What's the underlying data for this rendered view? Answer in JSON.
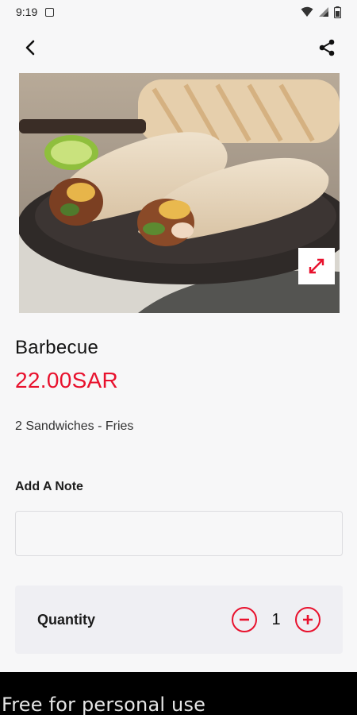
{
  "status_bar": {
    "time": "9:19",
    "icons": [
      "notification-icon",
      "wifi-icon",
      "signal-icon",
      "battery-icon"
    ]
  },
  "header": {
    "back_icon": "back-arrow-icon",
    "share_icon": "share-icon"
  },
  "product": {
    "image_alt": "Barbecue wrap sandwiches with fries",
    "expand_icon": "expand-icon",
    "name": "Barbecue",
    "price": "22.00SAR",
    "description": "2 Sandwiches - Fries"
  },
  "note": {
    "label": "Add A Note",
    "value": "",
    "placeholder": ""
  },
  "quantity": {
    "label": "Quantity",
    "value": "1",
    "decrement_icon": "minus-circle-icon",
    "increment_icon": "plus-circle-icon"
  },
  "colors": {
    "accent": "#e8112d",
    "background": "#f7f7f8",
    "card": "#efeff3",
    "footer": "#000000"
  },
  "watermark": "Free for personal use"
}
